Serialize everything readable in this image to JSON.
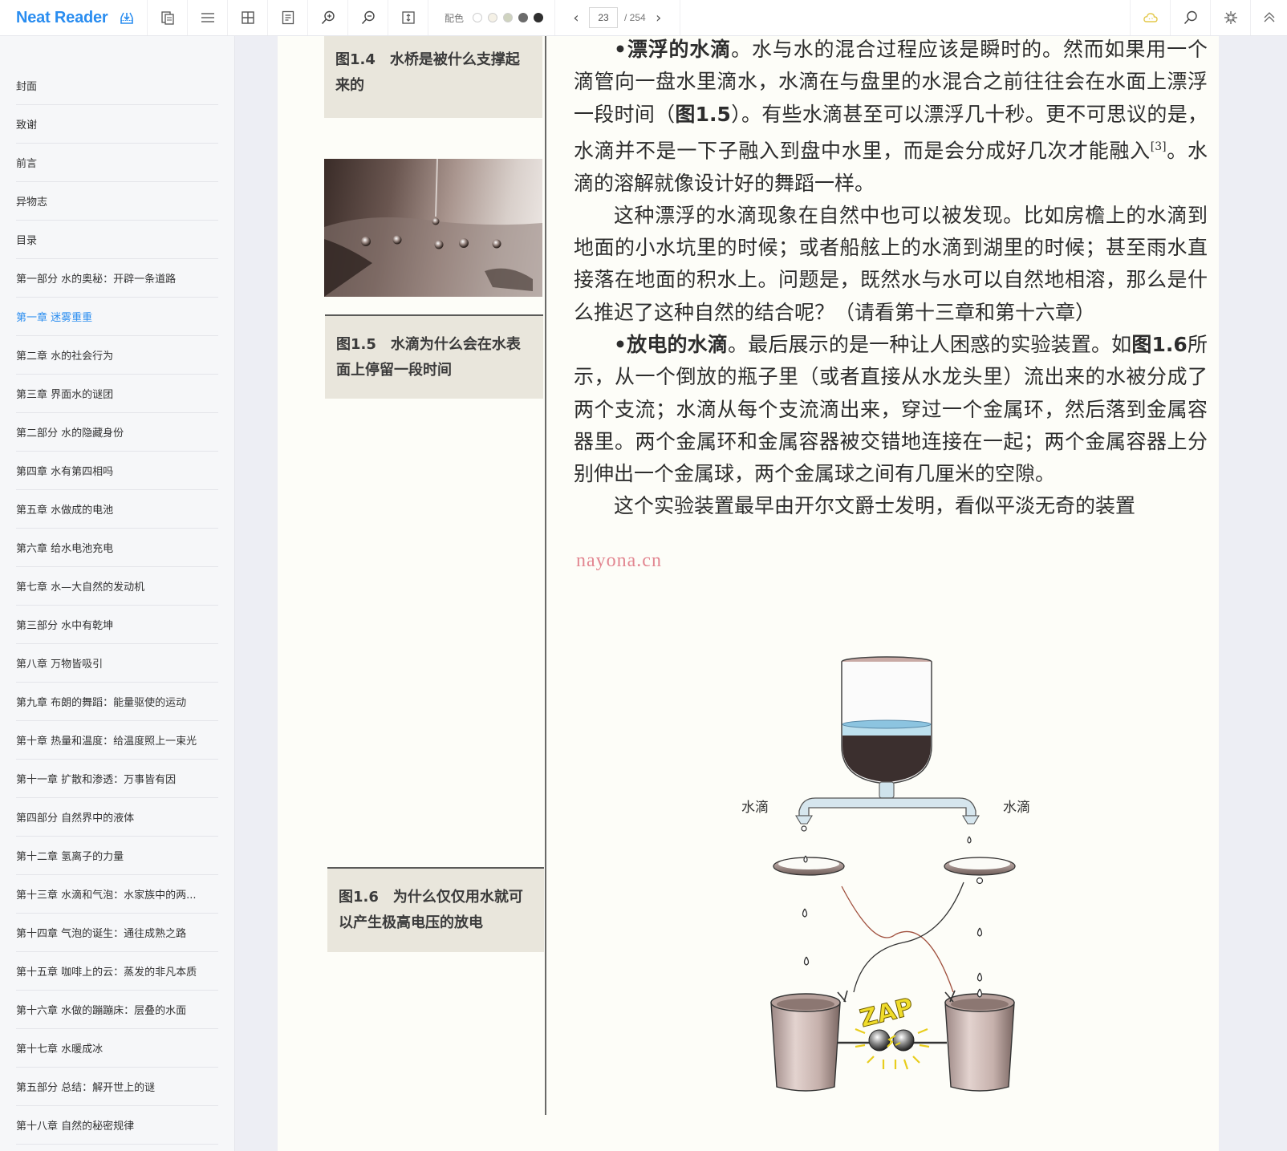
{
  "app": {
    "title": "Neat Reader",
    "brand_color": "#2a8df0"
  },
  "toolbar": {
    "left_icons": [
      {
        "name": "import-icon",
        "label": "Import"
      },
      {
        "name": "copy-pages-icon",
        "label": "Bookshelf"
      },
      {
        "name": "menu-icon",
        "label": "Table of contents"
      },
      {
        "name": "grid-icon",
        "label": "Layout"
      },
      {
        "name": "notes-icon",
        "label": "Notes"
      },
      {
        "name": "zoom-in-icon",
        "label": "Zoom in"
      },
      {
        "name": "zoom-out-icon",
        "label": "Zoom out"
      },
      {
        "name": "fit-height-icon",
        "label": "Fit height"
      }
    ],
    "color_scheme_label": "配色",
    "color_swatches": [
      "#ffffff",
      "#f5f1e6",
      "#cfd3bf",
      "#6b6b6b",
      "#2f2f2f"
    ],
    "pager": {
      "current_page": "23",
      "total_label": "/ 254",
      "prev_symbol": "‹",
      "next_symbol": "›"
    },
    "right_icons": [
      {
        "name": "cloud-sync-icon",
        "color": "#e3c84a"
      },
      {
        "name": "search-icon"
      },
      {
        "name": "collapse-icon"
      },
      {
        "name": "chevron-up-double-icon"
      }
    ]
  },
  "sidebar": {
    "active_index": 6,
    "items": [
      "封面",
      "致谢",
      "前言",
      "异物志",
      "目录",
      "第一部分 水的奥秘：开辟一条道路",
      "第一章 迷雾重重",
      "第二章 水的社会行为",
      "第三章 界面水的谜团",
      "第二部分 水的隐藏身份",
      "第四章 水有第四相吗",
      "第五章 水做成的电池",
      "第六章 给水电池充电",
      "第七章 水—大自然的发动机",
      "第三部分 水中有乾坤",
      "第八章 万物皆吸引",
      "第九章 布朗的舞蹈：能量驱使的运动",
      "第十章 热量和温度：给温度照上一束光",
      "第十一章 扩散和渗透：万事皆有因",
      "第四部分 自然界中的液体",
      "第十二章 氢离子的力量",
      "第十三章 水滴和气泡：水家族中的两...",
      "第十四章 气泡的诞生：通往成熟之路",
      "第十五章 咖啡上的云：蒸发的非凡本质",
      "第十六章 水做的蹦蹦床：层叠的水面",
      "第十七章 水暖成冰",
      "第五部分 总结：解开世上的谜",
      "第十八章 自然的秘密规律"
    ]
  },
  "page": {
    "captions": [
      {
        "num": "图1.4",
        "text": "水桥是被什么支撑起来的"
      },
      {
        "num": "图1.5",
        "text": "水滴为什么会在水表面上停留一段时间"
      },
      {
        "num": "图1.6",
        "text": "为什么仅仅用水就可以产生极高电压的放电"
      }
    ],
    "paragraphs": {
      "p1_bold": "•漂浮的水滴",
      "p1_a": "。水与水的混合过程应该是瞬时的。然而如果用一个滴管向一盘水里滴水，水滴在与盘里的水混合之前往往会在水面上漂浮一段时间（",
      "p1_ref": "图1.5",
      "p1_b": "）。有些水滴甚至可以漂浮几十秒。更不可思议的是，水滴并不是一下子融入到盘中水里，而是会分成好几次才能融入",
      "p1_sup": "[3]",
      "p1_c": "。水滴的溶解就像设计好的舞蹈一样。",
      "p2": "这种漂浮的水滴现象在自然中也可以被发现。比如房檐上的水滴到地面的小水坑里的时候；或者船舷上的水滴到湖里的时候；甚至雨水直接落在地面的积水上。问题是，既然水与水可以自然地相溶，那么是什么推迟了这种自然的结合呢？（请看第十三章和第十六章）",
      "p3_bold": "•放电的水滴",
      "p3_a": "。最后展示的是一种让人困惑的实验装置。如",
      "p3_ref": "图1.6",
      "p3_b": "所示，从一个倒放的瓶子里（或者直接从水龙头里）流出来的水被分成了两个支流；水滴从每个支流滴出来，穿过一个金属环，然后落到金属容器里。两个金属环和金属容器被交错地连接在一起；两个金属容器上分别伸出一个金属球，两个金属球之间有几厘米的空隙。",
      "p4": "这个实验装置最早由开尔文爵士发明，看似平淡无奇的装置"
    },
    "watermark": "nayona.cn",
    "diagram": {
      "left_label": "水滴",
      "right_label": "水滴",
      "zap_text": "ZAP"
    }
  }
}
